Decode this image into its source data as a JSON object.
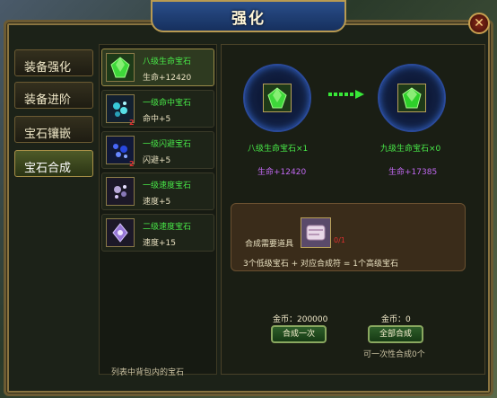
{
  "window": {
    "title": "强化"
  },
  "close_icon": "close-x-icon",
  "tabs": [
    {
      "label": "装备强化",
      "active": false
    },
    {
      "label": "装备进阶",
      "active": false
    },
    {
      "label": "宝石镶嵌",
      "active": false
    },
    {
      "label": "宝石合成",
      "active": true
    }
  ],
  "gem_list": {
    "items": [
      {
        "name": "八级生命宝石",
        "stat": "生命+12420",
        "count": "",
        "icon": "green-gem-icon",
        "selected": true
      },
      {
        "name": "一级命中宝石",
        "stat": "命中+5",
        "count": "2",
        "icon": "cyan-gem-icon",
        "selected": false
      },
      {
        "name": "一级闪避宝石",
        "stat": "闪避+5",
        "count": "2",
        "icon": "blue-gem-icon",
        "selected": false
      },
      {
        "name": "一级速度宝石",
        "stat": "速度+5",
        "count": "",
        "icon": "purple-gem-icon",
        "selected": false
      },
      {
        "name": "二级速度宝石",
        "stat": "速度+15",
        "count": "",
        "icon": "purple-gem-icon",
        "selected": false
      }
    ],
    "footer": "列表中背包内的宝石"
  },
  "synthesis": {
    "source": {
      "name": "八级生命宝石×1",
      "stat": "生命+12420"
    },
    "target": {
      "name": "九级生命宝石×0",
      "stat": "生命+17385"
    },
    "required_label": "合成需要道具",
    "required_count": "0/1",
    "rule": "3个低级宝石 + 对应合成符 = 1个高级宝石",
    "gold_left": "金币：200000",
    "gold_right": "金币：0",
    "btn_once": "合成一次",
    "btn_all": "全部合成",
    "hint": "可一次性合成0个"
  }
}
